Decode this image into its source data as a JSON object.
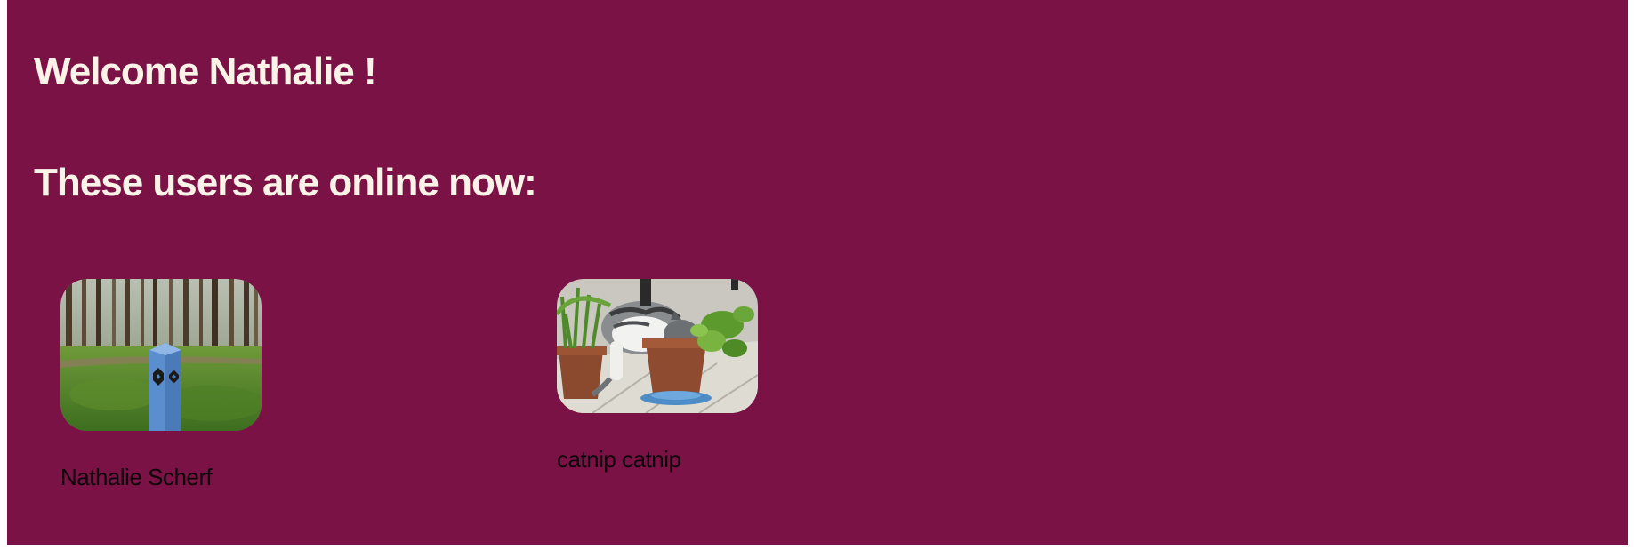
{
  "welcome": {
    "prefix": "Welcome",
    "user_first_name": "Nathalie",
    "suffix": "!",
    "text": "Welcome Nathalie !"
  },
  "online_heading": "These users are online now:",
  "online_users": [
    {
      "name": "Nathalie Scherf",
      "avatar_icon": "forest-marker-post-photo"
    },
    {
      "name": "catnip catnip",
      "avatar_icon": "cat-in-plant-pot-photo"
    }
  ],
  "colors": {
    "background": "#7a1245",
    "heading_text": "#fbf3e8",
    "name_text": "#0d0509"
  }
}
